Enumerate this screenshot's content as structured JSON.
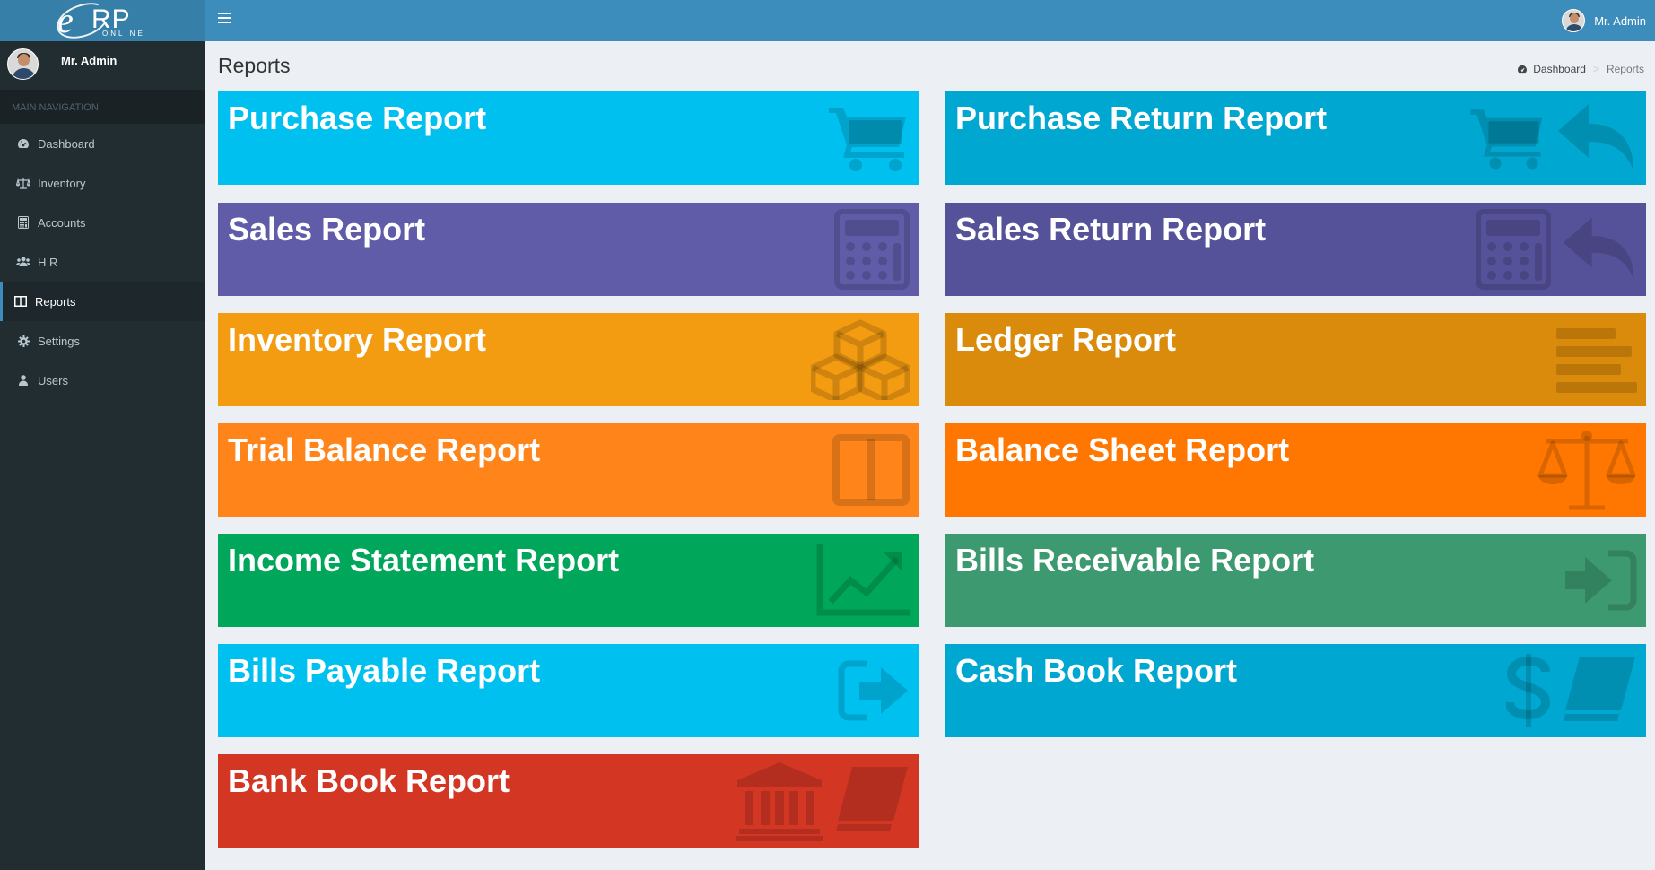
{
  "header": {
    "logo_letters": "RP",
    "logo_e": "e",
    "logo_sub": "ONLINE",
    "user_name": "Mr. Admin"
  },
  "sidebar": {
    "user_name": "Mr. Admin",
    "nav_header": "MAIN NAVIGATION",
    "items": [
      {
        "label": "Dashboard",
        "icon": "dashboard-icon"
      },
      {
        "label": "Inventory",
        "icon": "balance-scale-icon"
      },
      {
        "label": "Accounts",
        "icon": "calculator-icon"
      },
      {
        "label": "H R",
        "icon": "users-icon"
      },
      {
        "label": "Reports",
        "icon": "columns-icon",
        "active": true
      },
      {
        "label": "Settings",
        "icon": "gear-icon"
      },
      {
        "label": "Users",
        "icon": "user-icon"
      }
    ]
  },
  "page": {
    "title": "Reports",
    "breadcrumb": {
      "home": "Dashboard",
      "current": "Reports"
    }
  },
  "tiles": [
    {
      "label": "Purchase Report",
      "color": "#00c0ef",
      "icons": [
        "cart-icon"
      ]
    },
    {
      "label": "Purchase Return Report",
      "color": "#00a7d0",
      "icons": [
        "cart-icon",
        "reply-icon"
      ]
    },
    {
      "label": "Sales Report",
      "color": "#605ca8",
      "icons": [
        "calculator-icon"
      ]
    },
    {
      "label": "Sales Return Report",
      "color": "#555299",
      "icons": [
        "calculator-icon",
        "reply-icon"
      ]
    },
    {
      "label": "Inventory Report",
      "color": "#f39c12",
      "icons": [
        "cubes-icon"
      ]
    },
    {
      "label": "Ledger Report",
      "color": "#db8b0b",
      "icons": [
        "align-left-icon"
      ]
    },
    {
      "label": "Trial Balance Report",
      "color": "#ff851b",
      "icons": [
        "columns-icon"
      ]
    },
    {
      "label": "Balance Sheet Report",
      "color": "#ff7701",
      "icons": [
        "balance-scale-icon"
      ]
    },
    {
      "label": "Income Statement Report",
      "color": "#00a65a",
      "icons": [
        "line-chart-icon"
      ]
    },
    {
      "label": "Bills Receivable Report",
      "color": "#3d9970",
      "icons": [
        "sign-in-icon"
      ]
    },
    {
      "label": "Bills Payable Report",
      "color": "#00c0ef",
      "icons": [
        "sign-out-icon"
      ]
    },
    {
      "label": "Cash Book Report",
      "color": "#00a7d0",
      "icons": [
        "dollar-icon",
        "book-icon"
      ]
    },
    {
      "label": "Bank Book Report",
      "color": "#d33724",
      "icons": [
        "bank-icon",
        "book-icon"
      ]
    }
  ]
}
